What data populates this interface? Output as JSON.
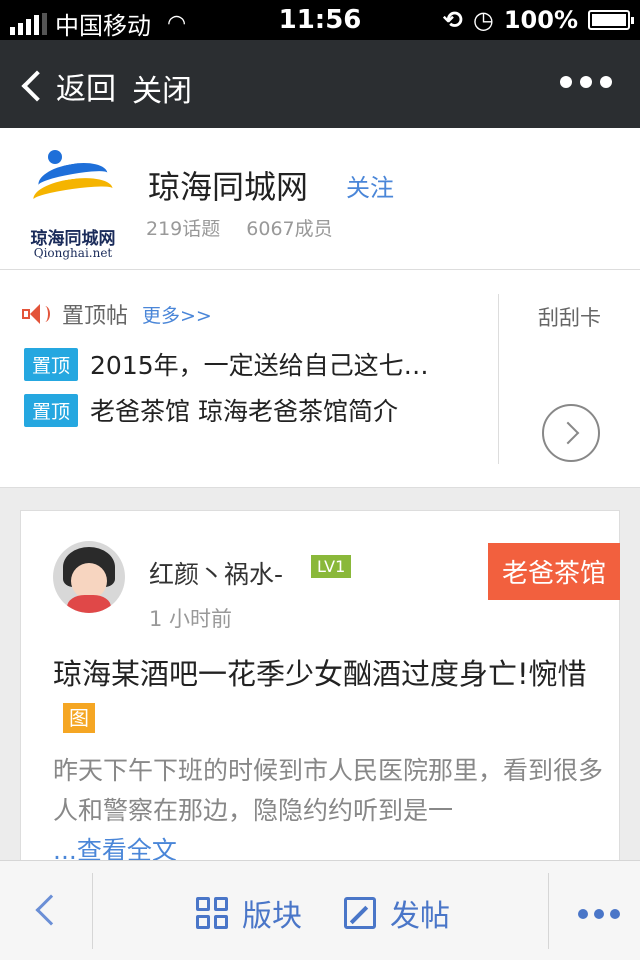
{
  "status_bar": {
    "carrier": "中国移动",
    "time": "11:56",
    "battery": "100%",
    "battery_level": 1.0
  },
  "navbar": {
    "back_label": "返回",
    "close_label": "关闭"
  },
  "forum": {
    "logo_title": "琼海同城网",
    "logo_domain": "Qionghai.net",
    "name": "琼海同城网",
    "follow_label": "关注",
    "topics": "219话题",
    "members": "6067成员"
  },
  "pinned": {
    "title": "置顶帖",
    "more_label": "更多>>",
    "card_label": "刮刮卡",
    "items": [
      {
        "tag": "置顶",
        "text": "2015年，一定送给自己这七…"
      },
      {
        "tag": "置顶",
        "text": "老爸茶馆 琼海老爸茶馆简介"
      }
    ]
  },
  "post": {
    "author": "红颜丶祸水-",
    "level": "LV1",
    "time": "1 小时前",
    "board": "老爸茶馆",
    "title": "琼海某酒吧一花季少女酗酒过度身亡!惋惜",
    "image_tag": "图",
    "excerpt": "昨天下午下班的时候到市人民医院那里，看到很多人和警察在那边，隐隐约约听到是一",
    "read_more": "...查看全文"
  },
  "bottom_bar": {
    "blocks_label": "版块",
    "post_label": "发帖"
  },
  "colors": {
    "accent": "#4a86d8",
    "tag": "#25a7e0",
    "board": "#f2603e",
    "level": "#8ab83a",
    "image_tag": "#f5a623"
  }
}
